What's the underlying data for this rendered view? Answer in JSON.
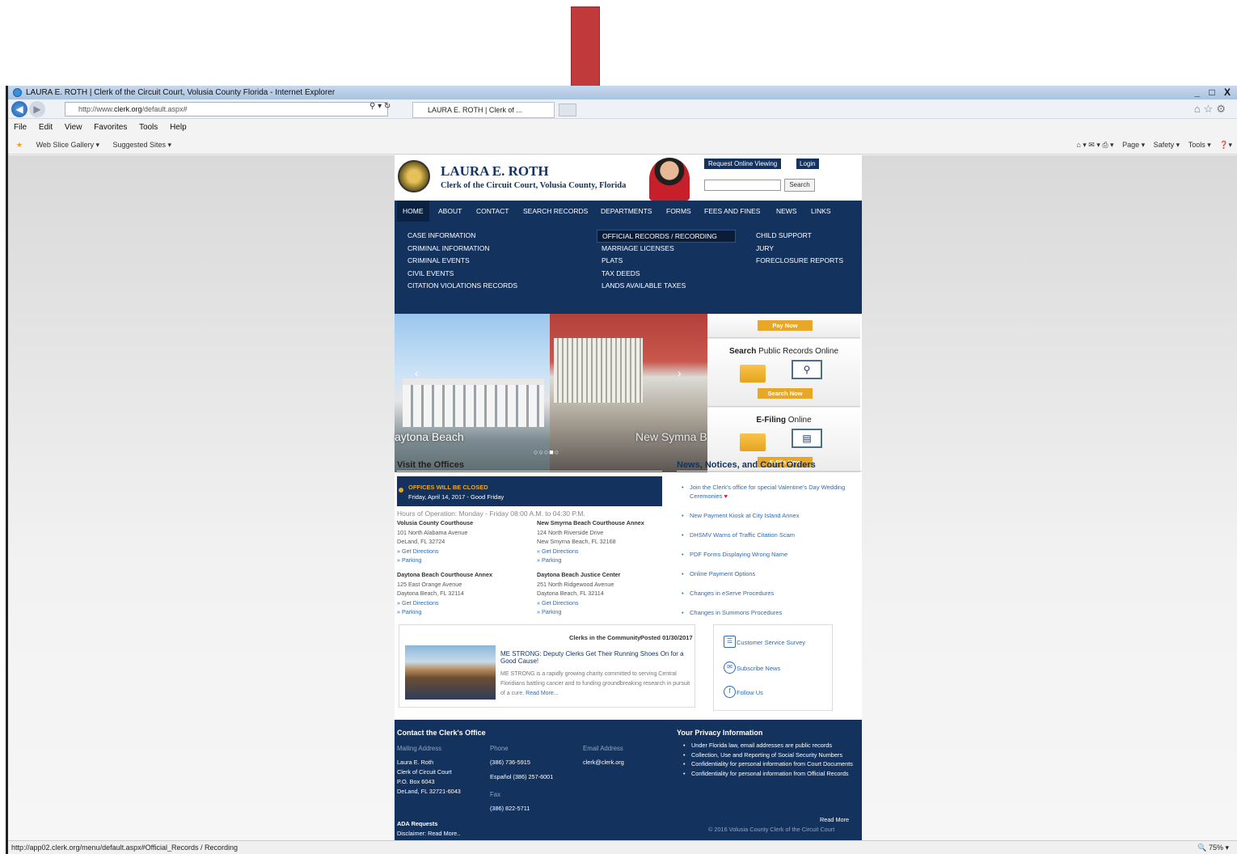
{
  "browser": {
    "window_title": "LAURA E. ROTH | Clerk of the Circuit Court, Volusia County Florida - Internet Explorer",
    "window_controls": "_ □ X",
    "url_prefix": "http://www.",
    "url_domain": "clerk.org",
    "url_path": "/default.aspx#",
    "tab_title": "LAURA E. ROTH | Clerk of ...",
    "menu": [
      "File",
      "Edit",
      "View",
      "Favorites",
      "Tools",
      "Help"
    ],
    "favorites": [
      "Web Slice Gallery ▾",
      "Suggested Sites ▾"
    ],
    "commands": [
      "Page ▾",
      "Safety ▾",
      "Tools ▾"
    ],
    "status_url": "http://app02.clerk.org/menu/default.aspx#Official_Records / Recording",
    "zoom": "75%"
  },
  "site": {
    "name": "LAURA E. ROTH",
    "subtitle": "Clerk of the Circuit Court, Volusia County, Florida",
    "request_button": "Request Online Viewing",
    "login_button": "Login",
    "search_button": "Search",
    "nav": [
      "HOME",
      "ABOUT",
      "CONTACT",
      "SEARCH RECORDS",
      "DEPARTMENTS",
      "FORMS",
      "FEES AND FINES",
      "NEWS",
      "LINKS"
    ],
    "mega_col1": [
      "CASE INFORMATION",
      "CRIMINAL INFORMATION",
      "CRIMINAL EVENTS",
      "CIVIL EVENTS",
      "CITATION VIOLATIONS RECORDS"
    ],
    "mega_col2": [
      "OFFICIAL RECORDS / RECORDING",
      "MARRIAGE LICENSES",
      "PLATS",
      "TAX DEEDS",
      "LANDS AVAILABLE TAXES"
    ],
    "mega_col3": [
      "CHILD SUPPORT",
      "JURY",
      "FORECLOSURE REPORTS"
    ],
    "slides": [
      "aytona Beach",
      "New Symna B"
    ],
    "panels": {
      "pay_button": "Pay Now",
      "search_title_bold": "Search",
      "search_title_rest": " Public Records Online",
      "search_button": "Search Now",
      "efile_title_bold": "E-Filing",
      "efile_title_rest": " Online",
      "efile_button": "E-File Now"
    },
    "visit": {
      "title": "Visit the Offices",
      "closed_head": "OFFICES WILL BE CLOSED",
      "closed_date": "Friday, April 14, 2017 - Good Friday",
      "hours": "Hours of Operation: Monday - Friday 08:00 A.M. to 04:30 P.M.",
      "offices": [
        {
          "name": "Volusia County Courthouse",
          "addr1": "101 North Alabama Avenue",
          "addr2": "DeLand, FL 32724",
          "link1": "» Get Directions",
          "link2": "» Parking"
        },
        {
          "name": "New Smyrna Beach Courthouse Annex",
          "addr1": "124 North Riverside Drive",
          "addr2": "New Smyrna Beach, FL 32168",
          "link1": "» Get Directions",
          "link2": "» Parking"
        },
        {
          "name": "Daytona Beach Courthouse Annex",
          "addr1": "125 East Orange Avenue",
          "addr2": "Daytona Beach, FL 32114",
          "link1": "» Get Directions",
          "link2": "» Parking"
        },
        {
          "name": "Daytona Beach Justice Center",
          "addr1": "251 North Ridgewood Avenue",
          "addr2": "Daytona Beach, FL 32114",
          "link1": "» Get Directions",
          "link2": "» Parking"
        }
      ]
    },
    "news": {
      "title": "News, Notices, and Court Orders",
      "items": [
        "Join the Clerk's office for special Valentine's Day Wedding Ceremonies",
        "New Payment Kiosk at City Island Annex",
        "DHSMV Warns of Traffic Citation Scam",
        "PDF Forms Displaying Wrong Name",
        "Online Payment Options",
        "Changes in eServe Procedures",
        "Changes in Summons Procedures"
      ]
    },
    "community": {
      "heading": "Clerks in the Community",
      "posted": "Posted 01/30/2017",
      "title": "ME STRONG: Deputy Clerks Get Their Running Shoes On for a Good Cause!",
      "body": "ME STRONG is a rapidly growing charity committed to serving Central Floridians battling cancer and to funding groundbreaking research in pursuit of a cure.",
      "read_more": "Read More..."
    },
    "social": [
      "Customer Service Survey",
      "Subscribe News",
      "Follow Us"
    ],
    "footer": {
      "contact_title": "Contact the Clerk's Office",
      "mailing_label": "Mailing Address",
      "mailing": [
        "Laura E. Roth",
        "Clerk of Circuit Court",
        "P.O. Box 6043",
        "DeLand, FL 32721-6043"
      ],
      "phone_label": "Phone",
      "phone": "(386) 736-5915",
      "phone_es": "Español (386) 257-6001",
      "fax_label": "Fax",
      "fax": "(386) 822-5711",
      "email_label": "Email Address",
      "email": "clerk@clerk.org",
      "ada": "ADA Requests",
      "disclaimer": "Disclaimer:   Read More..",
      "privacy_title": "Your Privacy Information",
      "privacy": [
        "Under Florida law, email addresses are public records",
        "Collection, Use and Reporting of Social Security Numbers",
        "Confidentiality for personal information from Court Documents",
        "Confidentiality for personal information from Official Records"
      ],
      "read_more": "Read More",
      "copyright": "© 2016 Volusia County Clerk of the Circuit Court"
    }
  },
  "colors": {
    "navy": "#14325e",
    "gold": "#e9a72a",
    "arrow": "#c0393b",
    "link": "#2c6bb1"
  }
}
